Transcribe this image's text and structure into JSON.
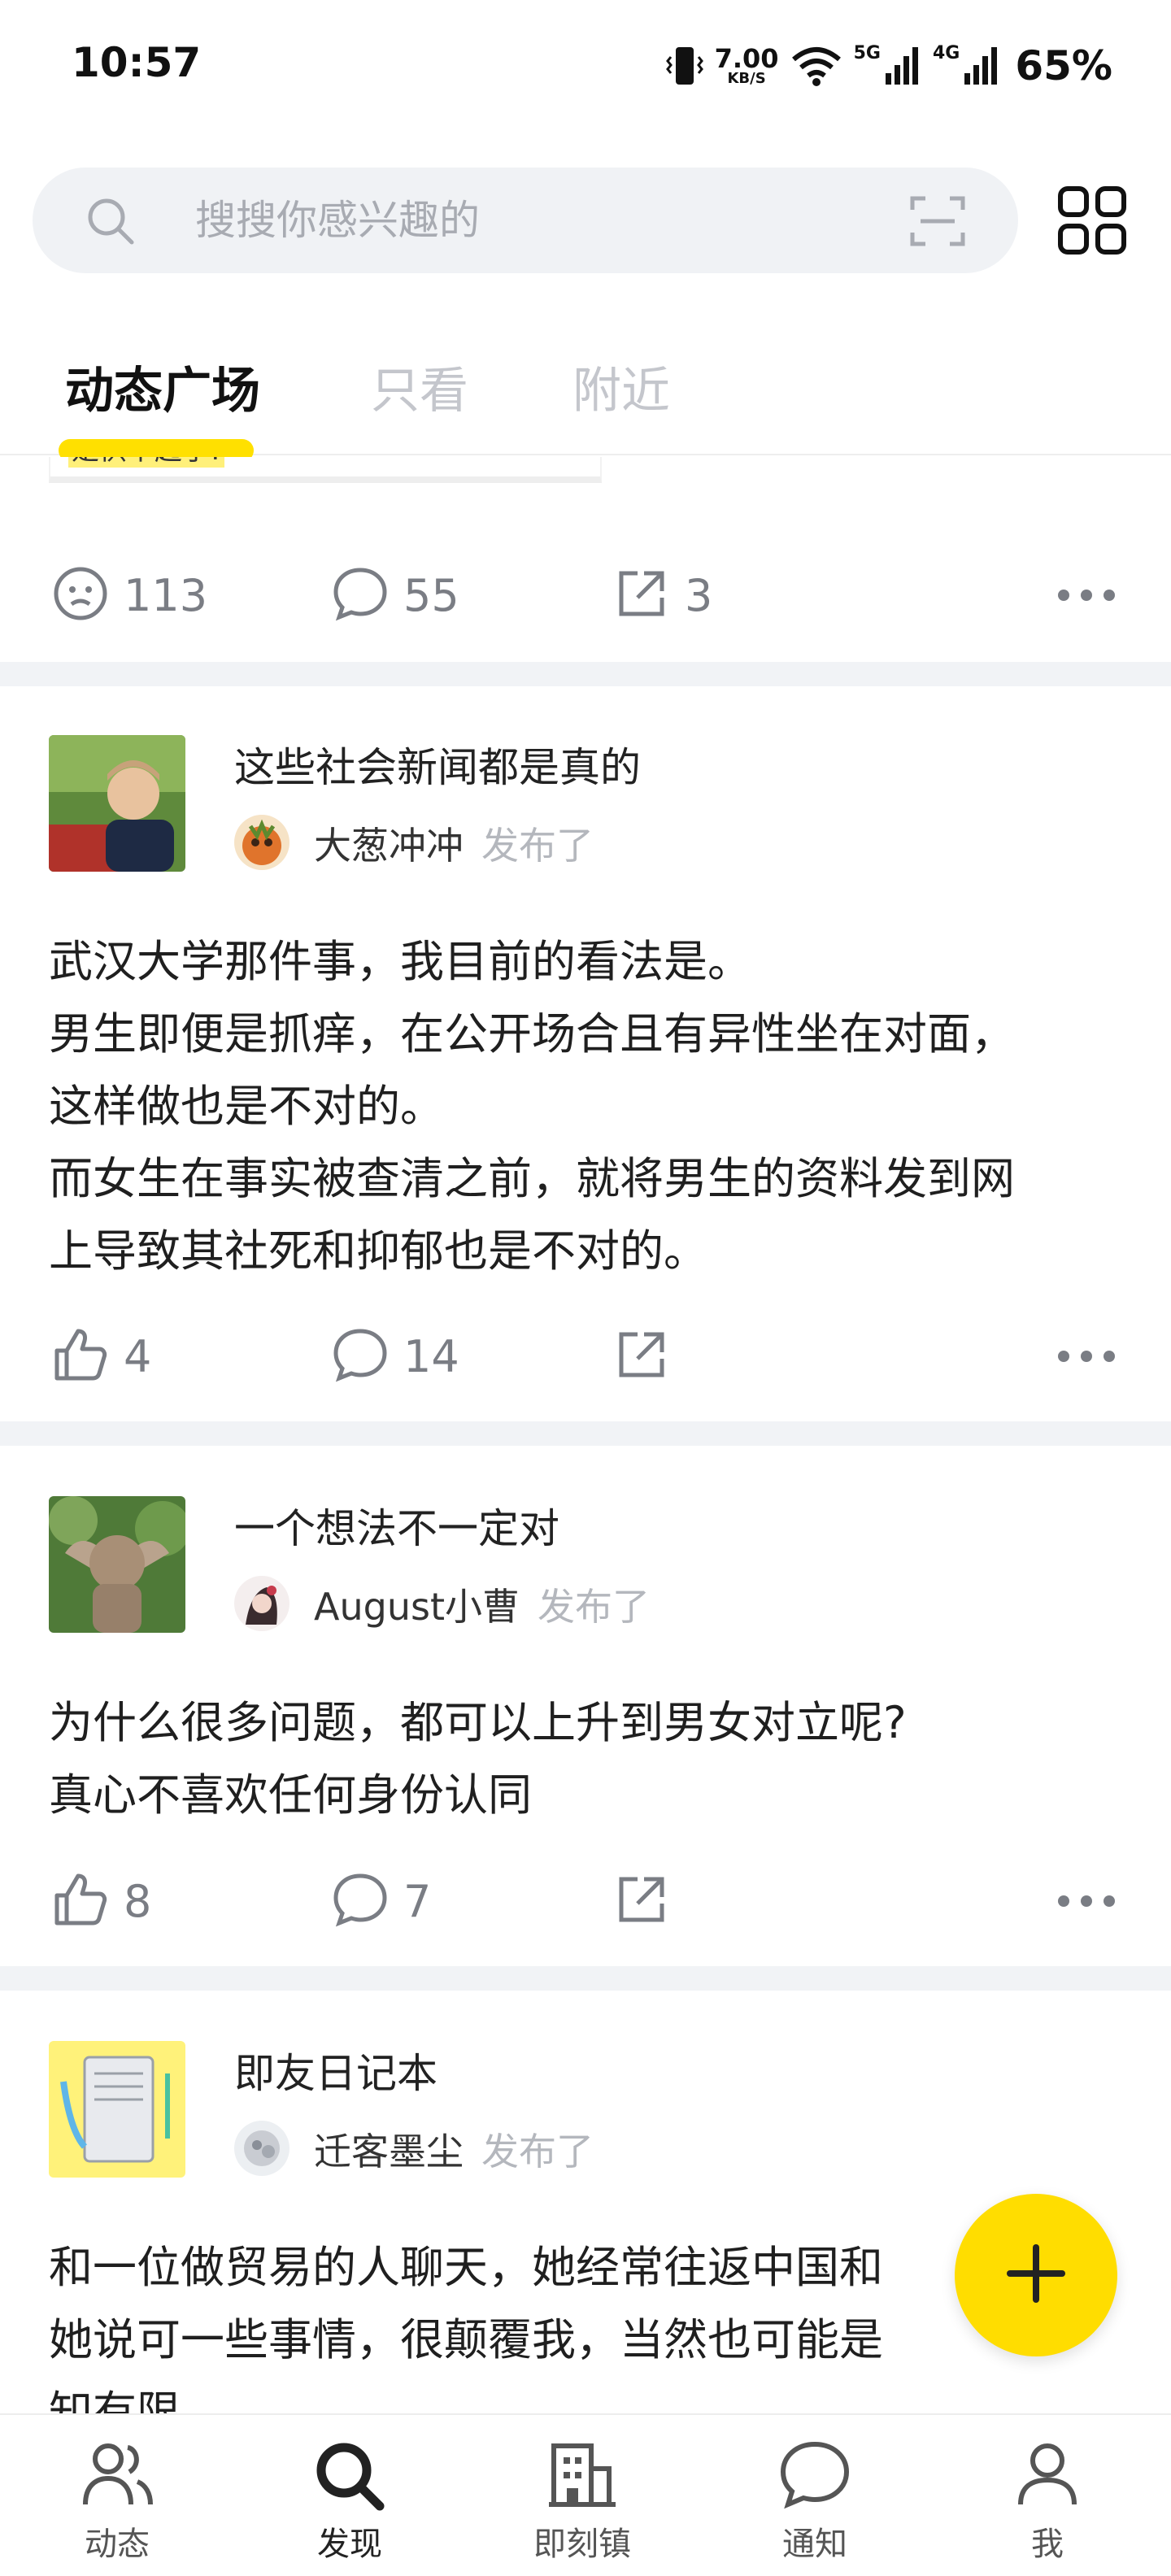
{
  "status_bar": {
    "time": "10:57",
    "net_speed_value": "7.00",
    "net_speed_unit": "KB/S",
    "sim1_label": "5G",
    "sim2_label": "4G",
    "battery": "65%"
  },
  "search": {
    "placeholder": "搜搜你感兴趣的"
  },
  "tabs": [
    {
      "label": "动态广场",
      "active": true
    },
    {
      "label": "只看",
      "active": false
    },
    {
      "label": "附近",
      "active": false
    }
  ],
  "colors": {
    "accent": "#ffdd00",
    "muted": "#7a7d84",
    "divider": "#f1f3f6"
  },
  "feed": {
    "partial_post": {
      "quote_text": "是供不起了!",
      "reaction_icon": "smiley-icon",
      "reactions": "113",
      "comments": "55",
      "shares": "3"
    },
    "posts": [
      {
        "topic": "这些社会新闻都是真的",
        "author": "大葱冲冲",
        "published_label": "发布了",
        "lines": [
          "武汉大学那件事，我目前的看法是。",
          "男生即便是抓痒，在公开场合且有异性坐在对面，",
          "这样做也是不对的。",
          "而女生在事实被查清之前，就将男生的资料发到网",
          "上导致其社死和抑郁也是不对的。"
        ],
        "likes": "4",
        "comments": "14"
      },
      {
        "topic": "一个想法不一定对",
        "author": "August小曹",
        "published_label": "发布了",
        "lines": [
          "为什么很多问题，都可以上升到男女对立呢?",
          "真心不喜欢任何身份认同"
        ],
        "likes": "8",
        "comments": "7"
      },
      {
        "topic": "即友日记本",
        "author": "迁客墨尘",
        "published_label": "发布了",
        "lines": [
          "和一位做贸易的人聊天，她经常往返中国和",
          "她说可一些事情，很颠覆我，当然也可能是",
          "知有限"
        ]
      }
    ]
  },
  "bottom_nav": [
    {
      "label": "动态",
      "icon": "people-icon"
    },
    {
      "label": "发现",
      "icon": "search-icon"
    },
    {
      "label": "即刻镇",
      "icon": "building-icon"
    },
    {
      "label": "通知",
      "icon": "chat-bubble-icon"
    },
    {
      "label": "我",
      "icon": "person-icon"
    }
  ]
}
